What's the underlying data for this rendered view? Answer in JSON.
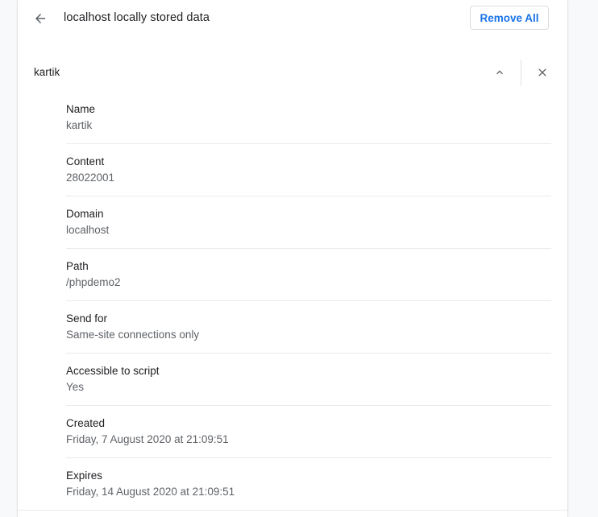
{
  "header": {
    "title": "localhost locally stored data",
    "remove_all_label": "Remove All",
    "back_icon": "arrow-back-icon"
  },
  "item": {
    "name": "kartik",
    "expand_icon": "chevron-up-icon",
    "close_icon": "close-icon"
  },
  "details": [
    {
      "label": "Name",
      "value": "kartik"
    },
    {
      "label": "Content",
      "value": "28022001"
    },
    {
      "label": "Domain",
      "value": "localhost"
    },
    {
      "label": "Path",
      "value": "/phpdemo2"
    },
    {
      "label": "Send for",
      "value": "Same-site connections only"
    },
    {
      "label": "Accessible to script",
      "value": "Yes"
    },
    {
      "label": "Created",
      "value": "Friday, 7 August 2020 at 21:09:51"
    },
    {
      "label": "Expires",
      "value": "Friday, 14 August 2020 at 21:09:51"
    }
  ],
  "colors": {
    "accent": "#1a73e8",
    "text_primary": "#202124",
    "text_secondary": "#5f6368",
    "divider": "#e8eaed"
  }
}
